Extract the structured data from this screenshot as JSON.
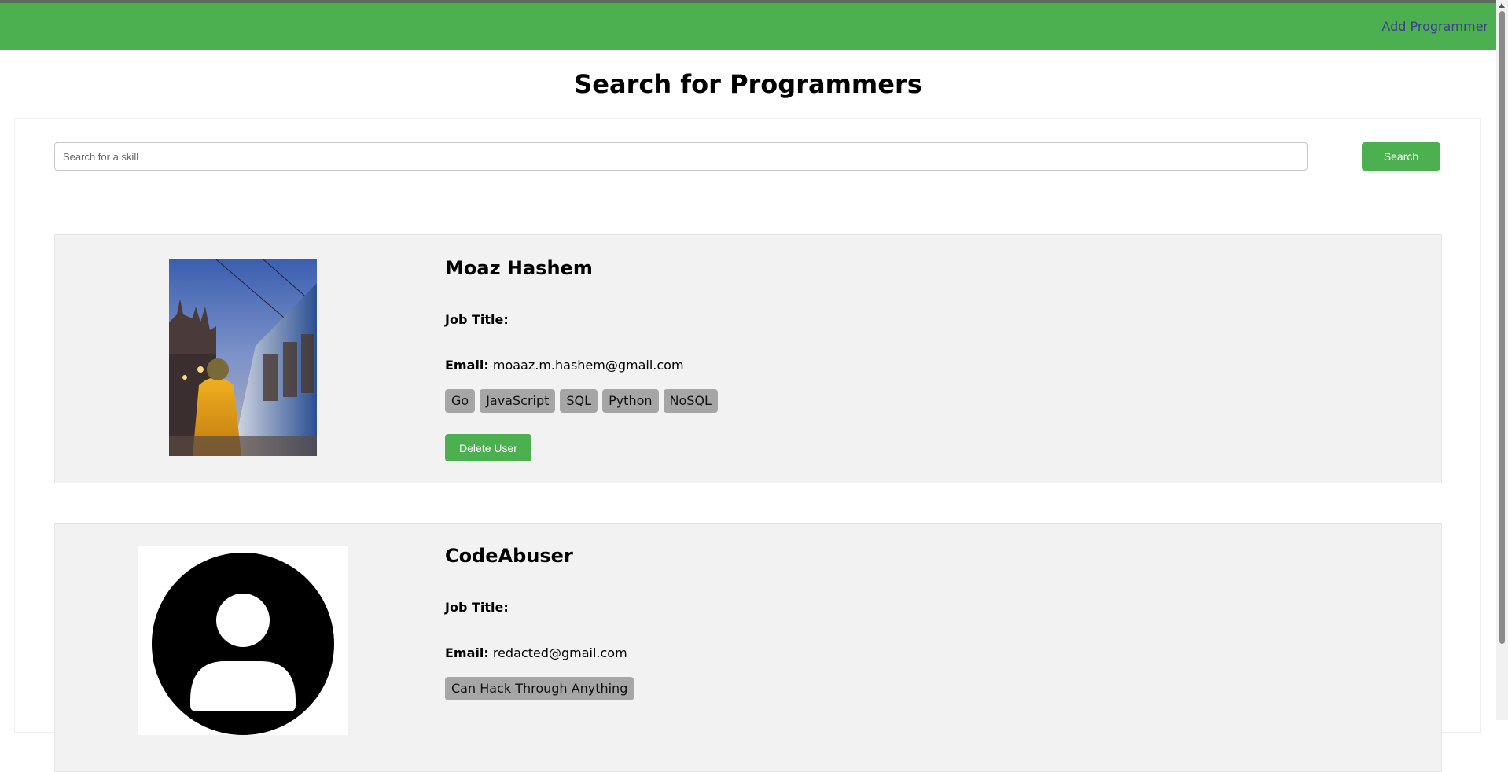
{
  "navbar": {
    "add_programmer_label": "Add Programmer",
    "color": "#4caf50"
  },
  "page": {
    "title": "Search for Programmers"
  },
  "search": {
    "placeholder": "Search for a skill",
    "value": "",
    "button_label": "Search"
  },
  "labels": {
    "job_title": "Job Title:",
    "email": "Email:",
    "delete_button": "Delete User"
  },
  "programmers": [
    {
      "name": "Moaz Hashem",
      "job_title": "",
      "email": "moaaz.m.hashem@gmail.com",
      "skills": [
        "Go",
        "JavaScript",
        "SQL",
        "Python",
        "NoSQL"
      ],
      "photo": "user-photo"
    },
    {
      "name": "CodeAbuser",
      "job_title": "",
      "email": "redacted@gmail.com",
      "skills": [
        "Can Hack Through Anything"
      ],
      "photo": "default-avatar-icon"
    }
  ]
}
